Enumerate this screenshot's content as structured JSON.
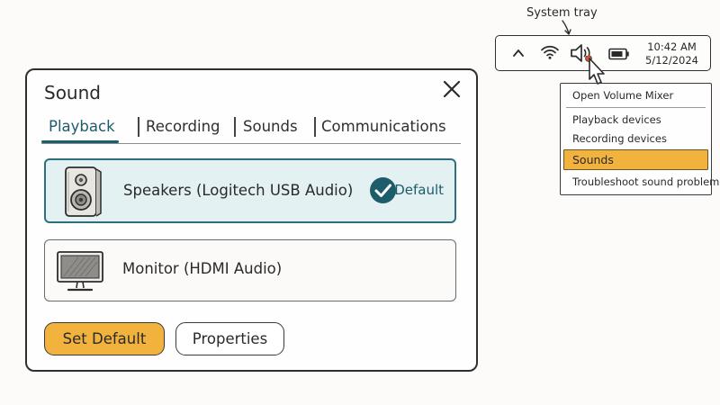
{
  "dialog": {
    "title": "Sound",
    "tabs": [
      {
        "label": "Playback",
        "active": true
      },
      {
        "label": "Recording",
        "active": false
      },
      {
        "label": "Sounds",
        "active": false
      },
      {
        "label": "Communications",
        "active": false
      }
    ],
    "devices": [
      {
        "name": "Speakers (Logitech USB Audio)",
        "icon": "speaker-icon",
        "selected": true,
        "badge": "Default"
      },
      {
        "name": "Monitor (HDMI Audio)",
        "icon": "monitor-icon",
        "selected": false
      }
    ],
    "buttons": {
      "set_default": "Set Default",
      "properties": "Properties"
    }
  },
  "tray": {
    "caption": "System tray",
    "icons": [
      "chevron-up-icon",
      "wifi-icon",
      "volume-icon",
      "battery-icon"
    ],
    "time": "10:42 AM",
    "date": "5/12/2024"
  },
  "context_menu": {
    "items": [
      "Open Volume Mixer",
      "Playback devices",
      "Recording devices",
      "Sounds",
      "Troubleshoot sound problems"
    ],
    "highlighted_index": 3
  },
  "colors": {
    "accent": "#1d5c6b",
    "selected_bg": "#e4f1f3",
    "highlight": "#f2b23e",
    "cursor_dot": "#e8512a"
  }
}
